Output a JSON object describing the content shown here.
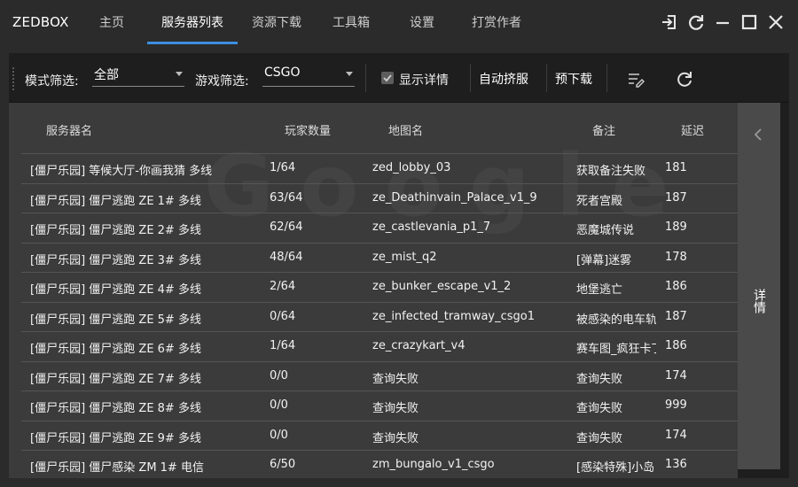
{
  "app": {
    "title": "ZEDBOX"
  },
  "nav": {
    "tabs": [
      {
        "label": "主页"
      },
      {
        "label": "服务器列表"
      },
      {
        "label": "资源下载"
      },
      {
        "label": "工具箱"
      },
      {
        "label": "设置"
      },
      {
        "label": "打赏作者"
      }
    ],
    "active_index": 1
  },
  "window_controls": [
    "login-icon",
    "refresh-icon",
    "minimize-icon",
    "maximize-icon",
    "close-icon"
  ],
  "toolbar": {
    "mode_filter_label": "模式筛选:",
    "mode_filter_value": "全部",
    "game_filter_label": "游戏筛选:",
    "game_filter_value": "CSGO",
    "show_details_label": "显示详情",
    "show_details_checked": true,
    "auto_join_label": "自动挤服",
    "predownload_label": "预下载",
    "icons": [
      "edit-list-icon",
      "refresh-list-icon"
    ]
  },
  "table": {
    "columns": [
      "服务器名",
      "玩家数量",
      "地图名",
      "备注",
      "延迟"
    ],
    "rows": [
      {
        "name": "[僵尸乐园] 等候大厅-你画我猜 多线",
        "players": "1/64",
        "map": "zed_lobby_03",
        "note": "获取备注失败",
        "ping": "181"
      },
      {
        "name": "[僵尸乐园] 僵尸逃跑 ZE 1# 多线",
        "players": "63/64",
        "map": "ze_Deathinvain_Palace_v1_9",
        "note": "死者宫殿",
        "ping": "187"
      },
      {
        "name": "[僵尸乐园] 僵尸逃跑 ZE 2# 多线",
        "players": "62/64",
        "map": "ze_castlevania_p1_7",
        "note": "恶魔城传说",
        "ping": "189"
      },
      {
        "name": "[僵尸乐园] 僵尸逃跑 ZE 3# 多线",
        "players": "48/64",
        "map": "ze_mist_q2",
        "note": "[弹幕]迷雾",
        "ping": "178"
      },
      {
        "name": "[僵尸乐园] 僵尸逃跑 ZE 4# 多线",
        "players": "2/64",
        "map": "ze_bunker_escape_v1_2",
        "note": "地堡逃亡",
        "ping": "186"
      },
      {
        "name": "[僵尸乐园] 僵尸逃跑 ZE 5# 多线",
        "players": "0/64",
        "map": "ze_infected_tramway_csgo1",
        "note": "被感染的电车轨",
        "ping": "187"
      },
      {
        "name": "[僵尸乐园] 僵尸逃跑 ZE 6# 多线",
        "players": "1/64",
        "map": "ze_crazykart_v4",
        "note": "赛车图_疯狂卡丁",
        "ping": "186"
      },
      {
        "name": "[僵尸乐园] 僵尸逃跑 ZE 7# 多线",
        "players": "0/0",
        "map": "查询失败",
        "note": "查询失败",
        "ping": "174"
      },
      {
        "name": "[僵尸乐园] 僵尸逃跑 ZE 8# 多线",
        "players": "0/0",
        "map": "查询失败",
        "note": "查询失败",
        "ping": "999"
      },
      {
        "name": "[僵尸乐园] 僵尸逃跑 ZE 9# 多线",
        "players": "0/0",
        "map": "查询失败",
        "note": "查询失败",
        "ping": "174"
      },
      {
        "name": "[僵尸乐园] 僵尸感染 ZM 1# 电信",
        "players": "6/50",
        "map": "zm_bungalo_v1_csgo",
        "note": "[感染特殊]小岛",
        "ping": "136"
      }
    ]
  },
  "detail_panel": {
    "label": "详情",
    "icon": "chevron-left-icon"
  },
  "colors": {
    "accent": "#3c8fe0",
    "background": "#2b2b2b",
    "table_bg": "#3b3b3b",
    "toolbar_bg": "#1e1e1e"
  }
}
